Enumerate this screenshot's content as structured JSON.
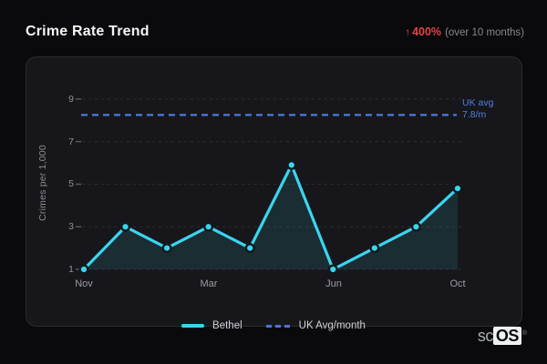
{
  "header": {
    "title": "Crime Rate Trend",
    "trend_arrow": "↑",
    "trend_value": "400%",
    "trend_caption": "(over 10 months)"
  },
  "chart_data": {
    "type": "line",
    "ylabel": "Crimes per 1,000",
    "ylim": [
      1,
      9
    ],
    "yticks": [
      1,
      3,
      5,
      7,
      9
    ],
    "xtick_labels": [
      "Nov",
      "Mar",
      "Jun",
      "Oct"
    ],
    "xtick_point_indices": [
      0,
      3,
      6,
      9
    ],
    "num_points": 10,
    "grid": "dashed horizontal gridlines",
    "legend_position": "bottom-center",
    "series": [
      {
        "name": "Bethel",
        "type": "line-area",
        "color": "#3ad5ef",
        "values": [
          1,
          3,
          2,
          3,
          2,
          5.9,
          1,
          2,
          3,
          4.8
        ]
      },
      {
        "name": "UK Avg/month",
        "type": "reference-dashed",
        "color": "#4a74d8",
        "value": 7.8,
        "display_y_value": 8.25,
        "label_line1": "UK avg",
        "label_line2": "7.8/m"
      }
    ]
  },
  "legend": {
    "items": [
      {
        "label": "Bethel"
      },
      {
        "label": "UK Avg/month"
      }
    ]
  },
  "footer_logo": {
    "prefix": "sc",
    "box": "OS",
    "registered": "®"
  },
  "colors": {
    "background": "#0a0a0d",
    "card_background": "#17171b",
    "card_border": "#2b2b31",
    "accent_cyan": "#3ad5ef",
    "accent_blue": "#4a74d8",
    "accent_red": "#e04343"
  }
}
